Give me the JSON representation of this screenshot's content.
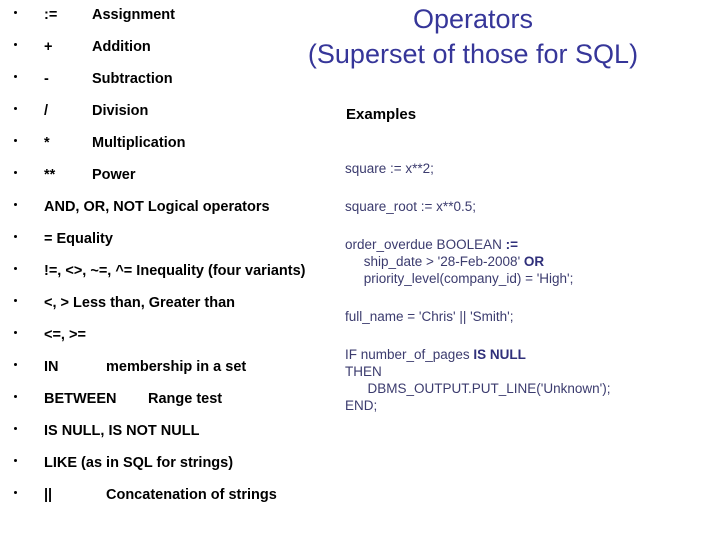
{
  "title": {
    "line1": "Operators",
    "line2": "(Superset of those for SQL)",
    "color": "#363699"
  },
  "examples_heading": "Examples",
  "operators": [
    {
      "symbol": ":=",
      "description": "Assignment",
      "mode": "split"
    },
    {
      "symbol": "+",
      "description": "Addition",
      "mode": "split"
    },
    {
      "symbol": "-",
      "description": "Subtraction",
      "mode": "split"
    },
    {
      "symbol": "/",
      "description": "Division",
      "mode": "split"
    },
    {
      "symbol": "*",
      "description": "Multiplication",
      "mode": "split"
    },
    {
      "symbol": "**",
      "description": "Power",
      "mode": "split"
    },
    {
      "symbol": "AND, OR, NOT Logical operators",
      "description": "",
      "mode": "full"
    },
    {
      "symbol": "= Equality",
      "description": "",
      "mode": "full"
    },
    {
      "symbol": "!=, <>, ~=, ^= Inequality (four variants)",
      "description": "",
      "mode": "full"
    },
    {
      "symbol": "<, >  Less than, Greater than",
      "description": "",
      "mode": "full"
    },
    {
      "symbol": "<=, >=",
      "description": "",
      "mode": "full"
    },
    {
      "symbol": "IN",
      "description": "membership in a set",
      "mode": "gap-wide"
    },
    {
      "symbol": "BETWEEN",
      "description": "Range test",
      "mode": "gap-betw"
    },
    {
      "symbol": "IS NULL, IS NOT NULL",
      "description": "",
      "mode": "full"
    },
    {
      "symbol": "LIKE (as in SQL for strings)",
      "description": "",
      "mode": "full"
    },
    {
      "symbol": "||",
      "description": "Concatenation of strings",
      "mode": "gap-wide"
    }
  ],
  "examples": [
    {
      "lines": [
        [
          {
            "t": "square := x**2;",
            "b": false
          }
        ]
      ]
    },
    {
      "lines": [
        [
          {
            "t": "square_root := x**0.5;",
            "b": false
          }
        ]
      ]
    },
    {
      "lines": [
        [
          {
            "t": "order_overdue BOOLEAN ",
            "b": false
          },
          {
            "t": ":=",
            "b": true
          }
        ],
        [
          {
            "t": "     ship_date > '28-Feb-2008' ",
            "b": false
          },
          {
            "t": "OR",
            "b": true
          }
        ],
        [
          {
            "t": "     priority_level(company_id) = 'High';",
            "b": false
          }
        ]
      ]
    },
    {
      "lines": [
        [
          {
            "t": "full_name = 'Chris' || 'Smith';",
            "b": false
          }
        ]
      ]
    },
    {
      "lines": [
        [
          {
            "t": "IF number_of_pages ",
            "b": false
          },
          {
            "t": "IS NULL",
            "b": true
          }
        ],
        [
          {
            "t": "THEN",
            "b": false
          }
        ],
        [
          {
            "t": "      DBMS_OUTPUT.PUT_LINE('Unknown');",
            "b": false
          }
        ],
        [
          {
            "t": "END;",
            "b": false
          }
        ]
      ]
    }
  ]
}
